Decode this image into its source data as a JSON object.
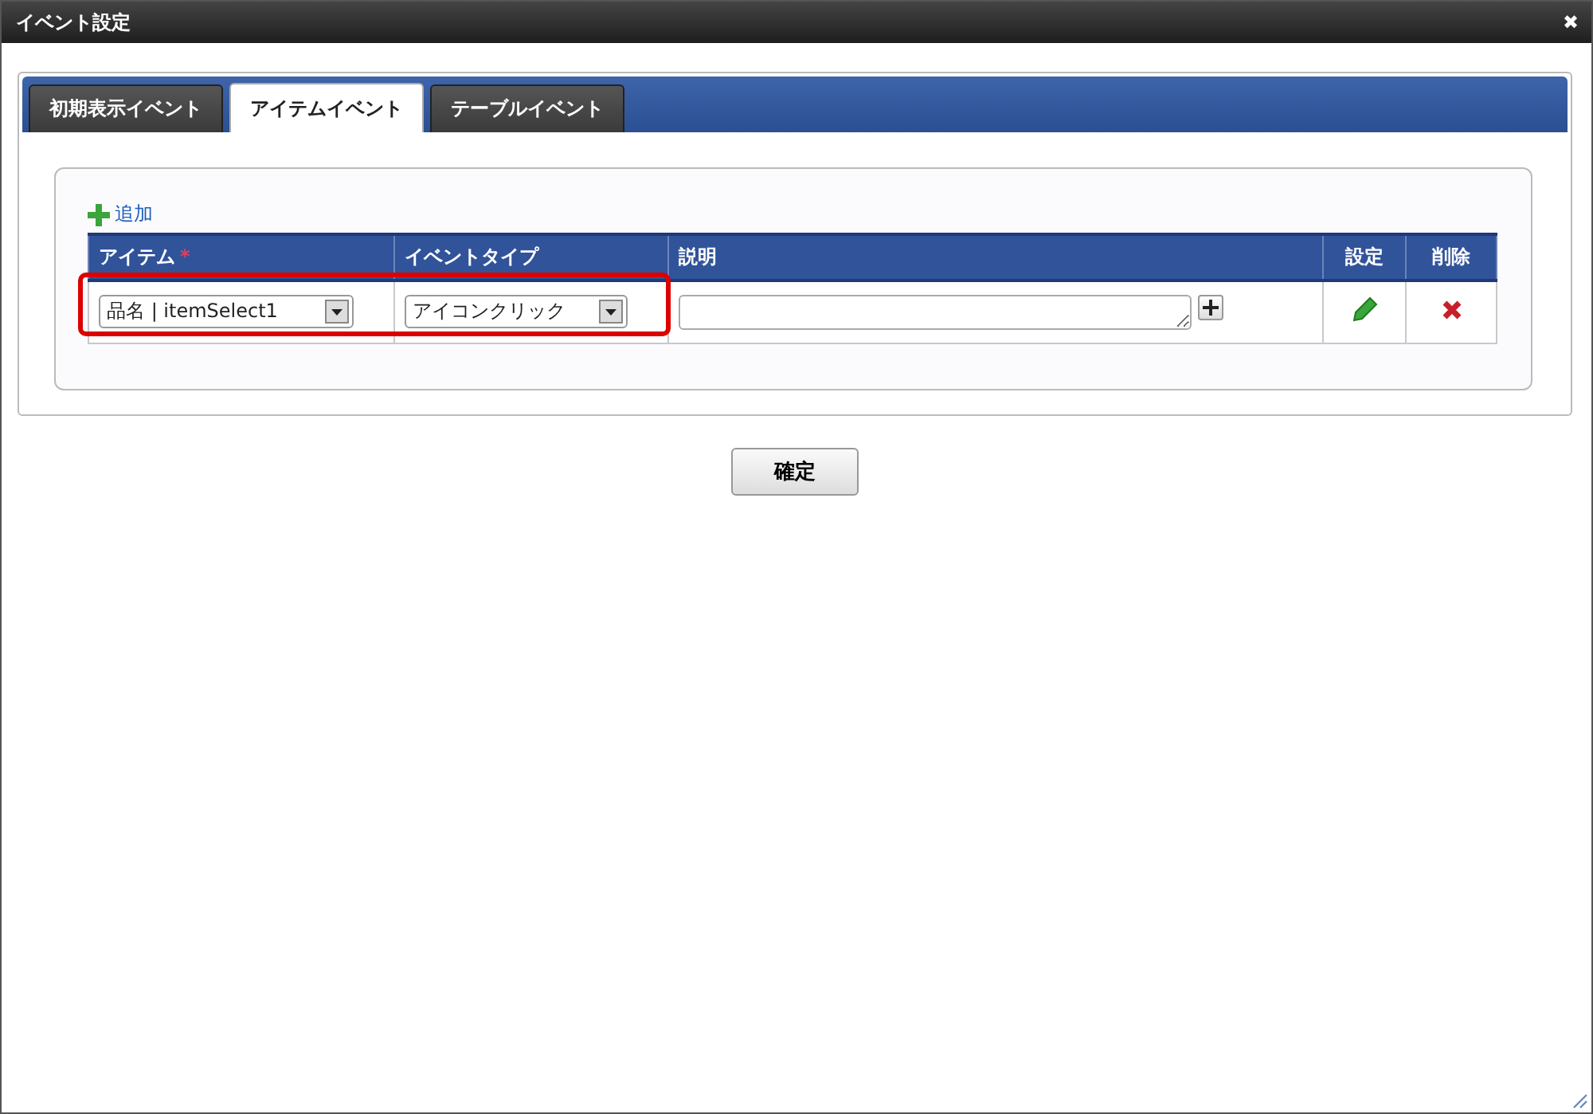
{
  "window": {
    "title": "イベント設定",
    "close": "✖"
  },
  "tabs": [
    {
      "label": "初期表示イベント",
      "selected": false
    },
    {
      "label": "アイテムイベント",
      "selected": true
    },
    {
      "label": "テーブルイベント",
      "selected": false
    }
  ],
  "add_link": "追加",
  "table": {
    "columns": [
      {
        "label": "アイテム",
        "required_mark": "*"
      },
      {
        "label": "イベントタイプ"
      },
      {
        "label": "説明"
      },
      {
        "label": "設定"
      },
      {
        "label": "削除"
      }
    ],
    "rows": [
      {
        "item": "品名 | itemSelect1",
        "event_type": "アイコンクリック",
        "highlighted": true
      }
    ]
  },
  "confirm_button": "確定"
}
